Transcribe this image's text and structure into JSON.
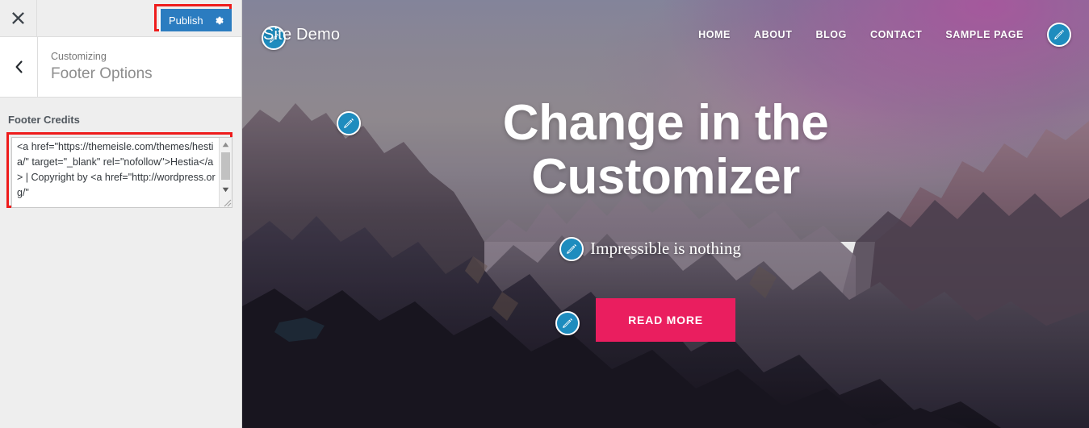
{
  "customizer": {
    "close_icon": "close-x-icon",
    "publish": {
      "label": "Publish",
      "gear_icon": "gear-icon",
      "background": "#2b7cc0",
      "highlight_color": "#ee1c1c"
    },
    "back_icon": "chevron-left-icon",
    "eyebrow": "Customizing",
    "section_title": "Footer Options",
    "field": {
      "label": "Footer Credits",
      "value": "<a href=\"https://themeisle.com/themes/hestia/\" target=\"_blank\" rel=\"nofollow\">Hestia</a> | Copyright by <a href=\"http://wordpress.org/\"",
      "highlight_color": "#ee1c1c",
      "scroll_up_icon": "scroll-up-arrow-icon",
      "scroll_down_icon": "scroll-down-arrow-icon",
      "resize_icon": "resize-handle-icon"
    }
  },
  "preview": {
    "brand": "Site Demo",
    "nav_items": [
      {
        "label": "HOME"
      },
      {
        "label": "ABOUT"
      },
      {
        "label": "BLOG"
      },
      {
        "label": "CONTACT"
      },
      {
        "label": "SAMPLE PAGE"
      }
    ],
    "nav_edit_icon": "edit-pencil-icon",
    "brand_edit_icon": "edit-pencil-icon",
    "hero": {
      "title": "Change in the Customizer",
      "subtitle": "Impressible is nothing",
      "button_label": "READ MORE",
      "button_color": "#ea1e5f",
      "title_edit_icon": "edit-pencil-icon",
      "subtitle_edit_icon": "edit-pencil-icon",
      "button_edit_icon": "edit-pencil-icon"
    }
  }
}
